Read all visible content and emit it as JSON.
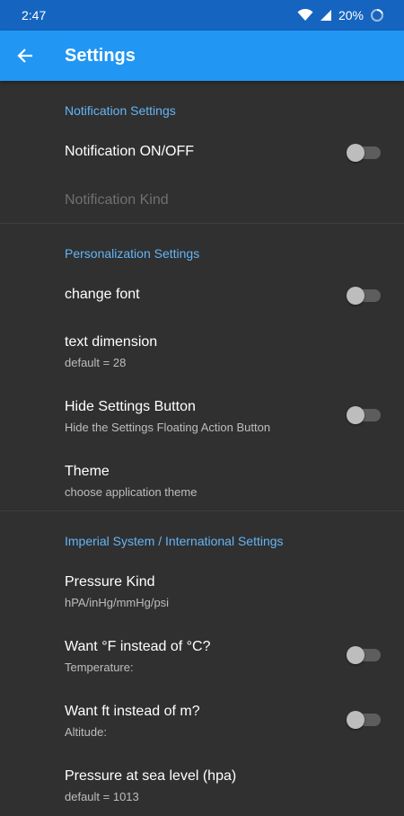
{
  "status_bar": {
    "time": "2:47",
    "battery": "20%",
    "icons": [
      "wifi-icon",
      "signal-icon",
      "battery-icon"
    ]
  },
  "app_bar": {
    "title": "Settings",
    "back_icon": "back-arrow-icon"
  },
  "sections": {
    "notification": {
      "header": "Notification Settings",
      "onoff": {
        "title": "Notification ON/OFF",
        "checked": false
      },
      "kind": {
        "title": "Notification Kind",
        "enabled": false
      }
    },
    "personalization": {
      "header": "Personalization Settings",
      "font": {
        "title": "change font",
        "checked": false
      },
      "text_dimension": {
        "title": "text dimension",
        "summary": "default = 28"
      },
      "hide_button": {
        "title": "Hide Settings Button",
        "summary": "Hide the Settings Floating Action Button",
        "checked": false
      },
      "theme": {
        "title": "Theme",
        "summary": "choose application theme"
      }
    },
    "units": {
      "header": "Imperial System / International Settings",
      "pressure_kind": {
        "title": "Pressure Kind",
        "summary": "hPA/inHg/mmHg/psi"
      },
      "fahrenheit": {
        "title": "Want °F instead of °C?",
        "summary": "Temperature:",
        "checked": false
      },
      "feet": {
        "title": "Want ft instead of m?",
        "summary": "Altitude:",
        "checked": false
      },
      "sea_level": {
        "title": "Pressure at sea level (hpa)",
        "summary": "default = 1013"
      }
    }
  },
  "colors": {
    "app_bar": "#2196f3",
    "status_bar": "#1565c0",
    "background": "#303030",
    "section_header": "#64b5f6"
  }
}
